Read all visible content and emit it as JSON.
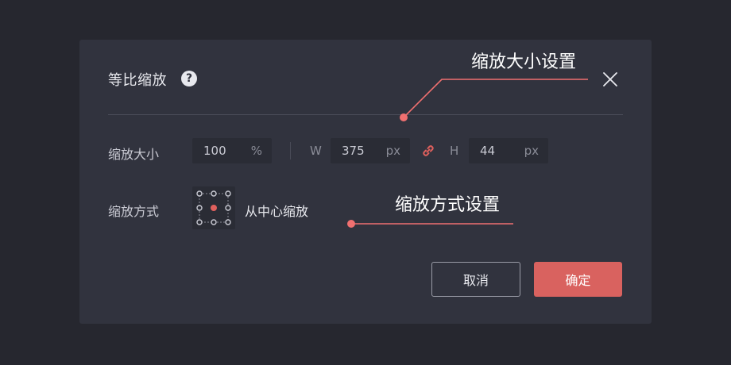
{
  "dialog": {
    "title": "等比缩放",
    "help_glyph": "?",
    "scale": {
      "label": "缩放大小",
      "percent_value": "100",
      "percent_unit": "%",
      "w_label": "W",
      "w_value": "375",
      "w_unit": "px",
      "h_label": "H",
      "h_value": "44",
      "h_unit": "px"
    },
    "mode": {
      "label": "缩放方式",
      "anchor_text": "从中心缩放"
    },
    "buttons": {
      "cancel": "取消",
      "ok": "确定"
    }
  },
  "annotations": {
    "scale_setting": "缩放大小设置",
    "mode_setting": "缩放方式设置"
  },
  "icons": {
    "help": "help-icon",
    "close": "close-icon",
    "link": "link-icon",
    "anchor": "anchor-grid-icon"
  },
  "colors": {
    "background": "#26272f",
    "dialog": "#31333e",
    "accent": "#d9625f",
    "annotation_line": "#f07070"
  }
}
